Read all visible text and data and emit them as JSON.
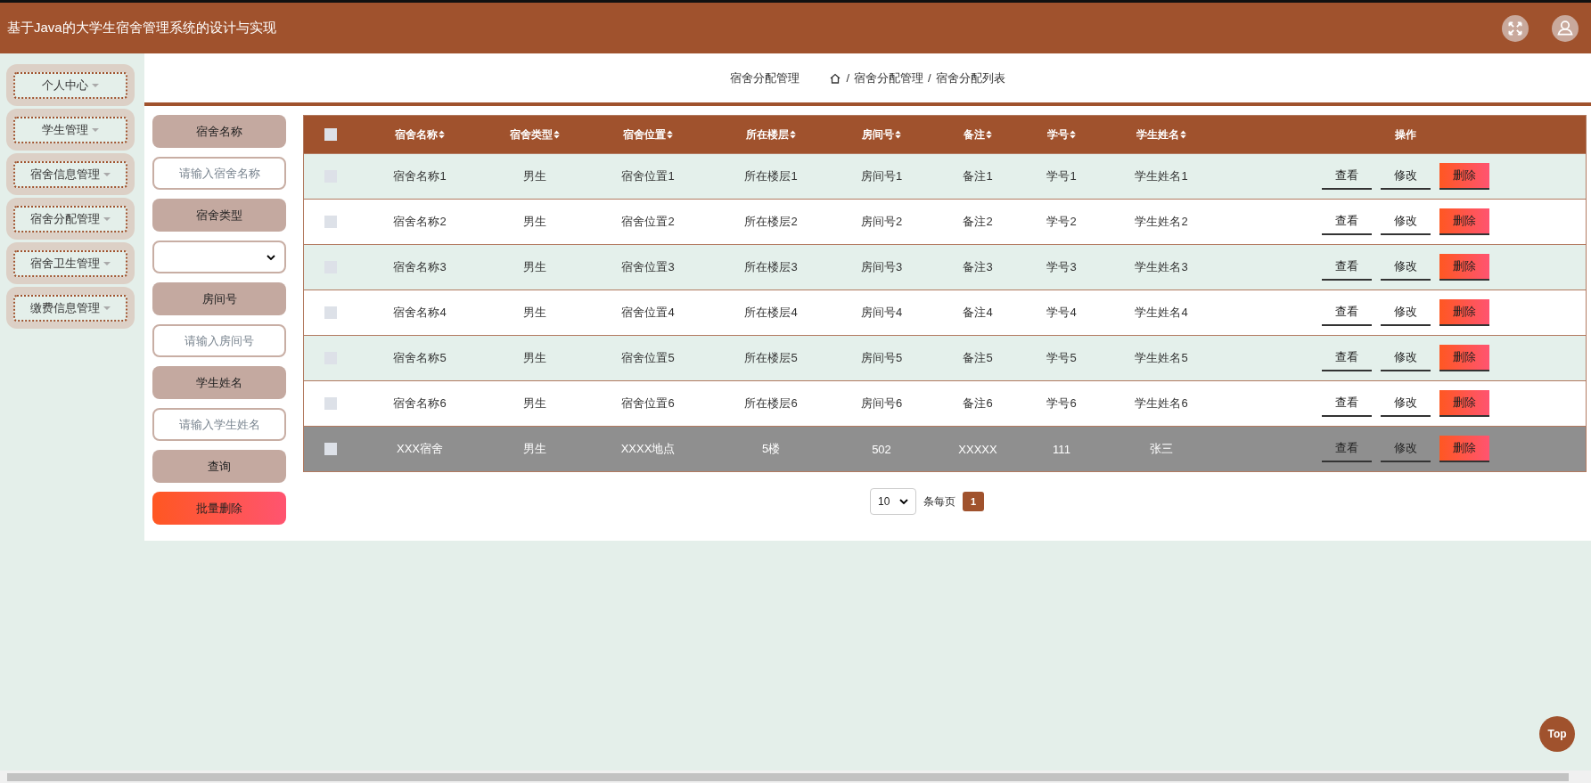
{
  "header": {
    "title": "基于Java的大学生宿舍管理系统的设计与实现"
  },
  "sidebar": {
    "items": [
      {
        "label": "个人中心"
      },
      {
        "label": "学生管理"
      },
      {
        "label": "宿舍信息管理"
      },
      {
        "label": "宿舍分配管理"
      },
      {
        "label": "宿舍卫生管理"
      },
      {
        "label": "缴费信息管理"
      }
    ]
  },
  "breadcrumb": {
    "page_title": "宿舍分配管理",
    "separator": "/",
    "path": [
      "宿舍分配管理",
      "宿舍分配列表"
    ]
  },
  "filters": [
    {
      "kind": "label",
      "text": "宿舍名称"
    },
    {
      "kind": "input",
      "placeholder": "请输入宿舍名称"
    },
    {
      "kind": "label",
      "text": "宿舍类型"
    },
    {
      "kind": "select"
    },
    {
      "kind": "label",
      "text": "房间号"
    },
    {
      "kind": "input",
      "placeholder": "请输入房间号"
    },
    {
      "kind": "label",
      "text": "学生姓名"
    },
    {
      "kind": "input",
      "placeholder": "请输入学生姓名"
    },
    {
      "kind": "button",
      "text": "查询"
    },
    {
      "kind": "danger",
      "text": "批量删除"
    }
  ],
  "table": {
    "select_all_checked": false,
    "columns": [
      "宿舍名称",
      "宿舍类型",
      "宿舍位置",
      "所在楼层",
      "房间号",
      "备注",
      "学号",
      "学生姓名"
    ],
    "action_header": "操作",
    "rows": [
      {
        "checked": false,
        "highlighted": false,
        "cells": [
          "宿舍名称1",
          "男生",
          "宿舍位置1",
          "所在楼层1",
          "房间号1",
          "备注1",
          "学号1",
          "学生姓名1"
        ],
        "actions": [
          {
            "label": "查看",
            "kind": "plain"
          },
          {
            "label": "修改",
            "kind": "plain"
          },
          {
            "label": "删除",
            "kind": "danger"
          }
        ]
      },
      {
        "checked": false,
        "highlighted": false,
        "cells": [
          "宿舍名称2",
          "男生",
          "宿舍位置2",
          "所在楼层2",
          "房间号2",
          "备注2",
          "学号2",
          "学生姓名2"
        ],
        "actions": [
          {
            "label": "查看",
            "kind": "plain"
          },
          {
            "label": "修改",
            "kind": "plain"
          },
          {
            "label": "删除",
            "kind": "danger"
          }
        ]
      },
      {
        "checked": false,
        "highlighted": false,
        "cells": [
          "宿舍名称3",
          "男生",
          "宿舍位置3",
          "所在楼层3",
          "房间号3",
          "备注3",
          "学号3",
          "学生姓名3"
        ],
        "actions": [
          {
            "label": "查看",
            "kind": "plain"
          },
          {
            "label": "修改",
            "kind": "plain"
          },
          {
            "label": "删除",
            "kind": "danger"
          }
        ]
      },
      {
        "checked": false,
        "highlighted": false,
        "cells": [
          "宿舍名称4",
          "男生",
          "宿舍位置4",
          "所在楼层4",
          "房间号4",
          "备注4",
          "学号4",
          "学生姓名4"
        ],
        "actions": [
          {
            "label": "查看",
            "kind": "plain"
          },
          {
            "label": "修改",
            "kind": "plain"
          },
          {
            "label": "删除",
            "kind": "danger"
          }
        ]
      },
      {
        "checked": false,
        "highlighted": false,
        "cells": [
          "宿舍名称5",
          "男生",
          "宿舍位置5",
          "所在楼层5",
          "房间号5",
          "备注5",
          "学号5",
          "学生姓名5"
        ],
        "actions": [
          {
            "label": "查看",
            "kind": "plain"
          },
          {
            "label": "修改",
            "kind": "plain"
          },
          {
            "label": "删除",
            "kind": "danger"
          }
        ]
      },
      {
        "checked": false,
        "highlighted": false,
        "cells": [
          "宿舍名称6",
          "男生",
          "宿舍位置6",
          "所在楼层6",
          "房间号6",
          "备注6",
          "学号6",
          "学生姓名6"
        ],
        "actions": [
          {
            "label": "查看",
            "kind": "plain"
          },
          {
            "label": "修改",
            "kind": "plain"
          },
          {
            "label": "删除",
            "kind": "danger"
          }
        ]
      },
      {
        "checked": false,
        "highlighted": true,
        "cells": [
          "XXX宿舍",
          "男生",
          "XXXX地点",
          "5楼",
          "502",
          "XXXXX",
          "111",
          "张三"
        ],
        "actions": [
          {
            "label": "查看",
            "kind": "plain"
          },
          {
            "label": "修改",
            "kind": "plain"
          },
          {
            "label": "删除",
            "kind": "danger"
          }
        ]
      }
    ]
  },
  "pagination": {
    "page_size": "10",
    "label": "条每页",
    "pages": [
      {
        "label": "1",
        "selected": true
      }
    ]
  },
  "back_to_top": "Top"
}
